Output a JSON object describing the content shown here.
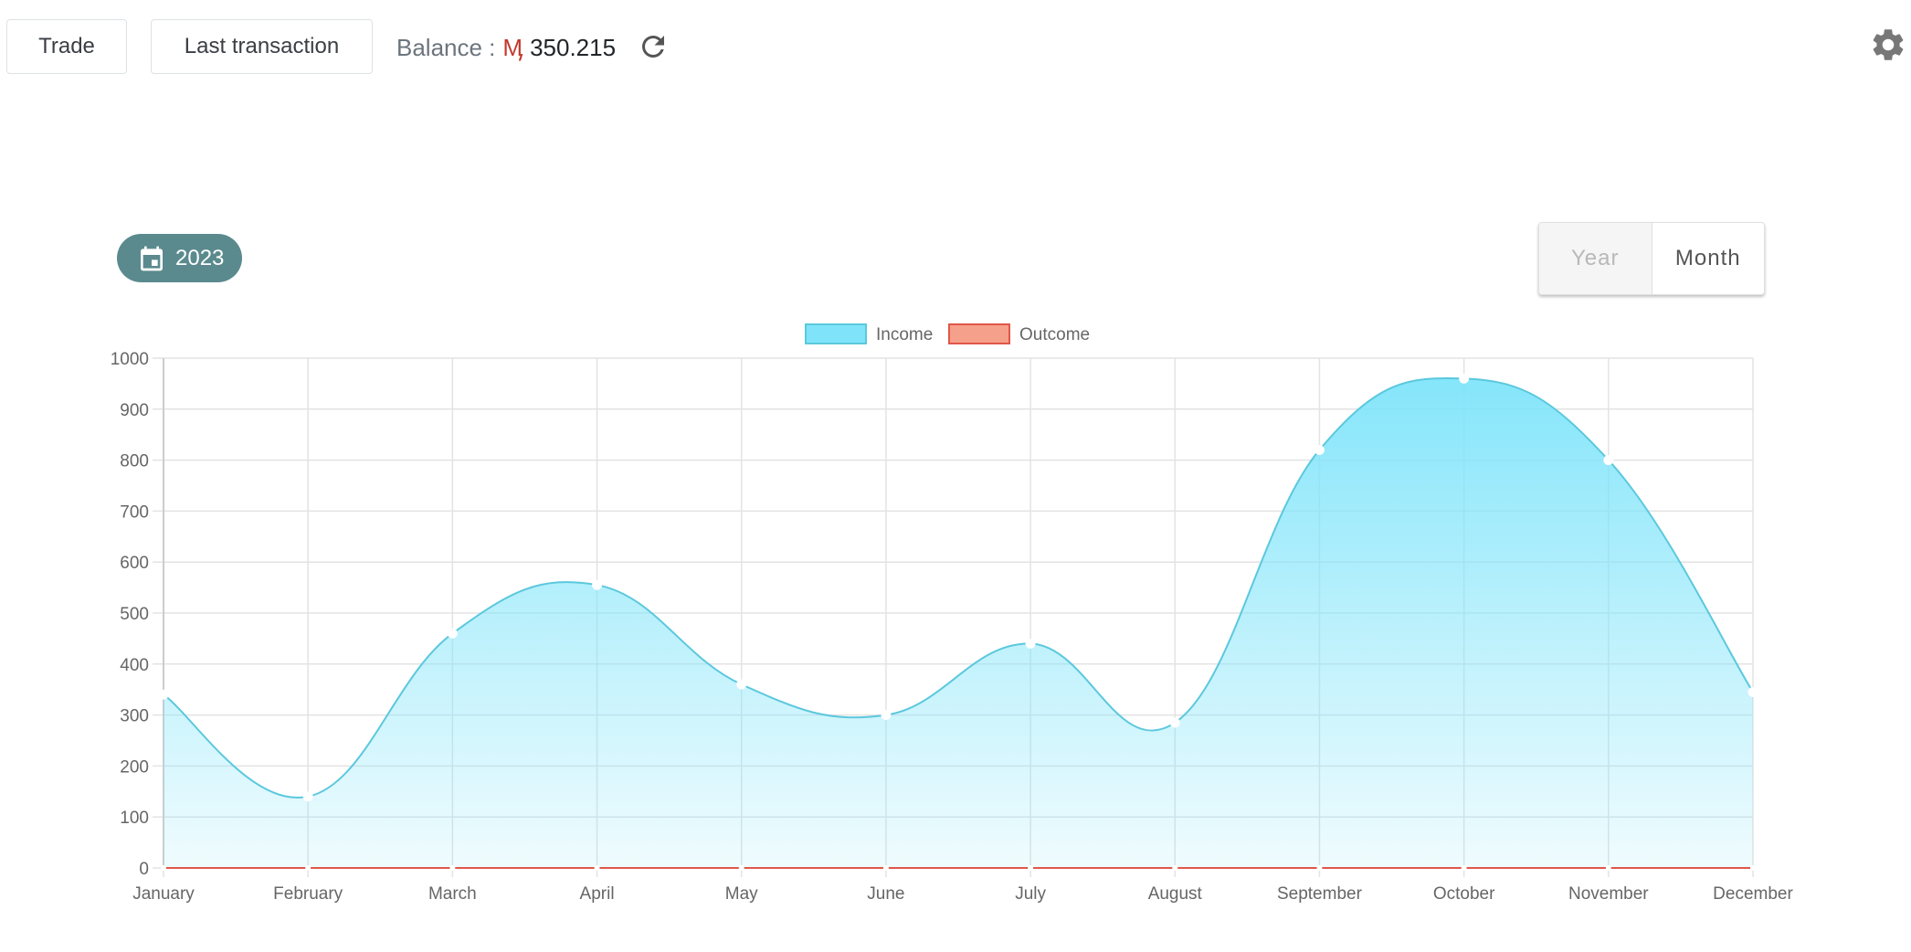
{
  "toolbar": {
    "trade_label": "Trade",
    "last_transaction_label": "Last transaction",
    "balance_label": "Balance :",
    "balance_currency": "Ӎ",
    "balance_value": "350.215",
    "refresh_icon": "refresh-icon",
    "settings_icon": "gear-icon"
  },
  "filters": {
    "year_label": "2023",
    "year_icon": "calendar-icon",
    "badge_color": "#5a8a8e",
    "toggle": {
      "year_label": "Year",
      "month_label": "Month",
      "active": "Month"
    }
  },
  "chart_data": {
    "type": "area",
    "categories": [
      "January",
      "February",
      "March",
      "April",
      "May",
      "June",
      "July",
      "August",
      "September",
      "October",
      "November",
      "December"
    ],
    "series": [
      {
        "name": "Income",
        "values": [
          340,
          140,
          460,
          555,
          360,
          300,
          440,
          285,
          820,
          960,
          800,
          345
        ],
        "color": "#5bc8dd",
        "fill": "#7fe4fa"
      },
      {
        "name": "Outcome",
        "values": [
          0,
          0,
          0,
          0,
          0,
          0,
          0,
          0,
          0,
          0,
          0,
          0
        ],
        "color": "#e0574a",
        "fill": "#f5a08a"
      }
    ],
    "ylim": [
      0,
      1000
    ],
    "yticks": [
      "0",
      "100",
      "200",
      "300",
      "400",
      "500",
      "600",
      "700",
      "800",
      "900",
      "1000"
    ],
    "grid": true,
    "legend": "top-center",
    "smooth": true
  }
}
